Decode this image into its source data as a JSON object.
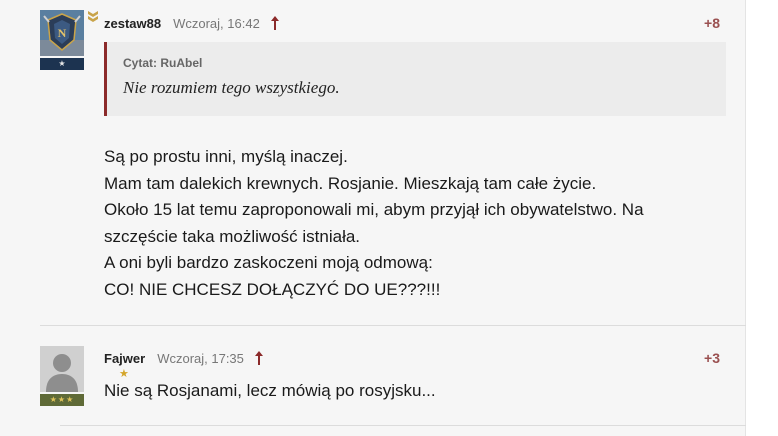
{
  "comments": [
    {
      "username": "zestaw88",
      "timestamp": "Wczoraj, 16:42",
      "score": "+8",
      "avatar_icon": "military-emblem-avatar",
      "rank_mark": "★",
      "quote": {
        "cite": "Cytat: RuAbel",
        "text": "Nie rozumiem tego wszystkiego."
      },
      "lines": [
        "Są po prostu inni, myślą inaczej.",
        "Mam tam dalekich krewnych. Rosjanie. Mieszkają tam całe życie.",
        "Około 15 lat temu zaproponowali mi, abym przyjął ich obywatelstwo. Na",
        "szczęście taka możliwość istniała.",
        "A oni byli bardzo zaskoczeni moją odmową:",
        "CO! NIE CHCESZ DOŁĄCZYĆ DO UE???!!!"
      ]
    },
    {
      "username": "Fajwer",
      "timestamp": "Wczoraj, 17:35",
      "score": "+3",
      "avatar_icon": "default-user-avatar",
      "rank_mark": "★★★",
      "lines": [
        "Nie są Rosjanami, lecz mówią po rosyjsku..."
      ]
    }
  ],
  "colors": {
    "accent": "#8b2a2a",
    "score": "#9a5050",
    "quote_bg": "#ececec",
    "rank_blue": "#1c3350",
    "rank_olive": "#5f6a37"
  }
}
